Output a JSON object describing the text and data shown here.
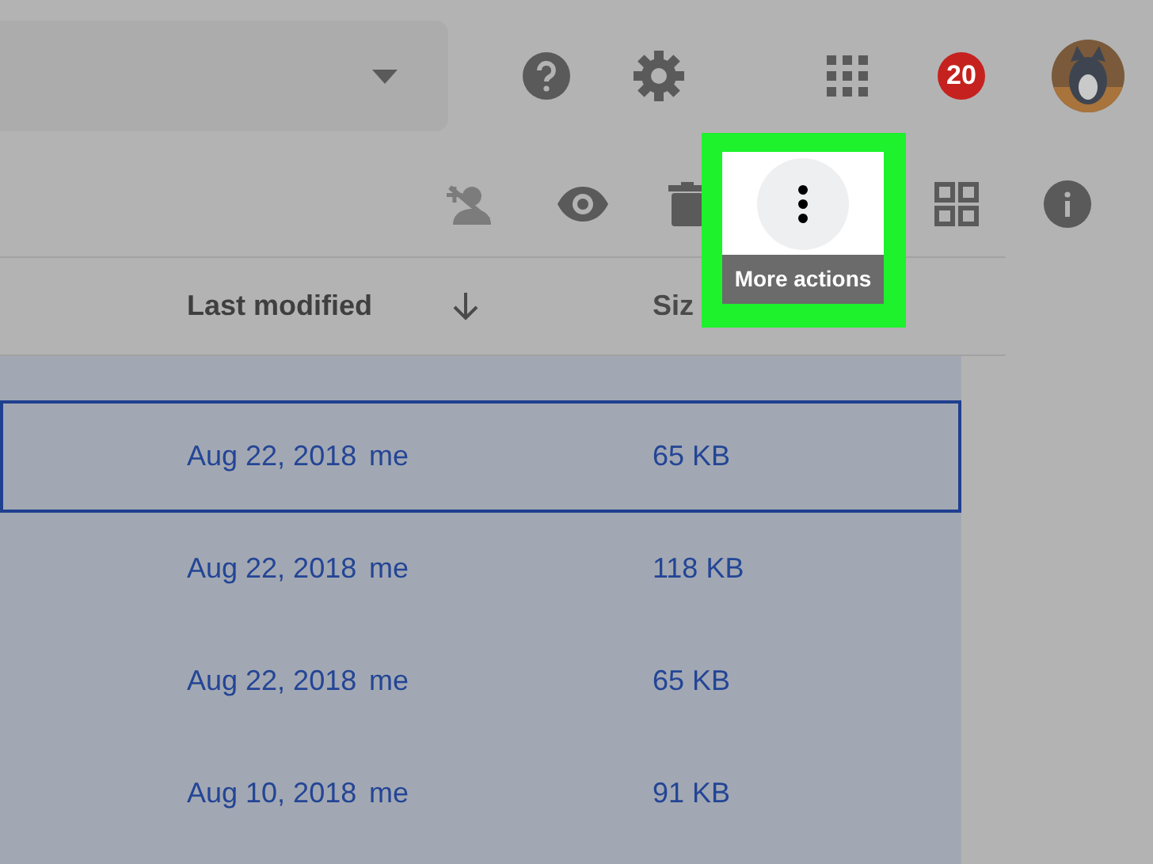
{
  "notification_count": "20",
  "toolbar": {
    "tooltip": "More actions",
    "highlighted": true
  },
  "columns": [
    {
      "label": "Last modified",
      "sorted": true
    },
    {
      "label": "Siz"
    }
  ],
  "rows": [
    {
      "modified": "Aug 22, 2018",
      "owner": "me",
      "size": "65 KB",
      "selected": true
    },
    {
      "modified": "Aug 22, 2018",
      "owner": "me",
      "size": "118 KB",
      "selected": false
    },
    {
      "modified": "Aug 22, 2018",
      "owner": "me",
      "size": "65 KB",
      "selected": false
    },
    {
      "modified": "Aug 10, 2018",
      "owner": "me",
      "size": "91 KB",
      "selected": false
    }
  ]
}
